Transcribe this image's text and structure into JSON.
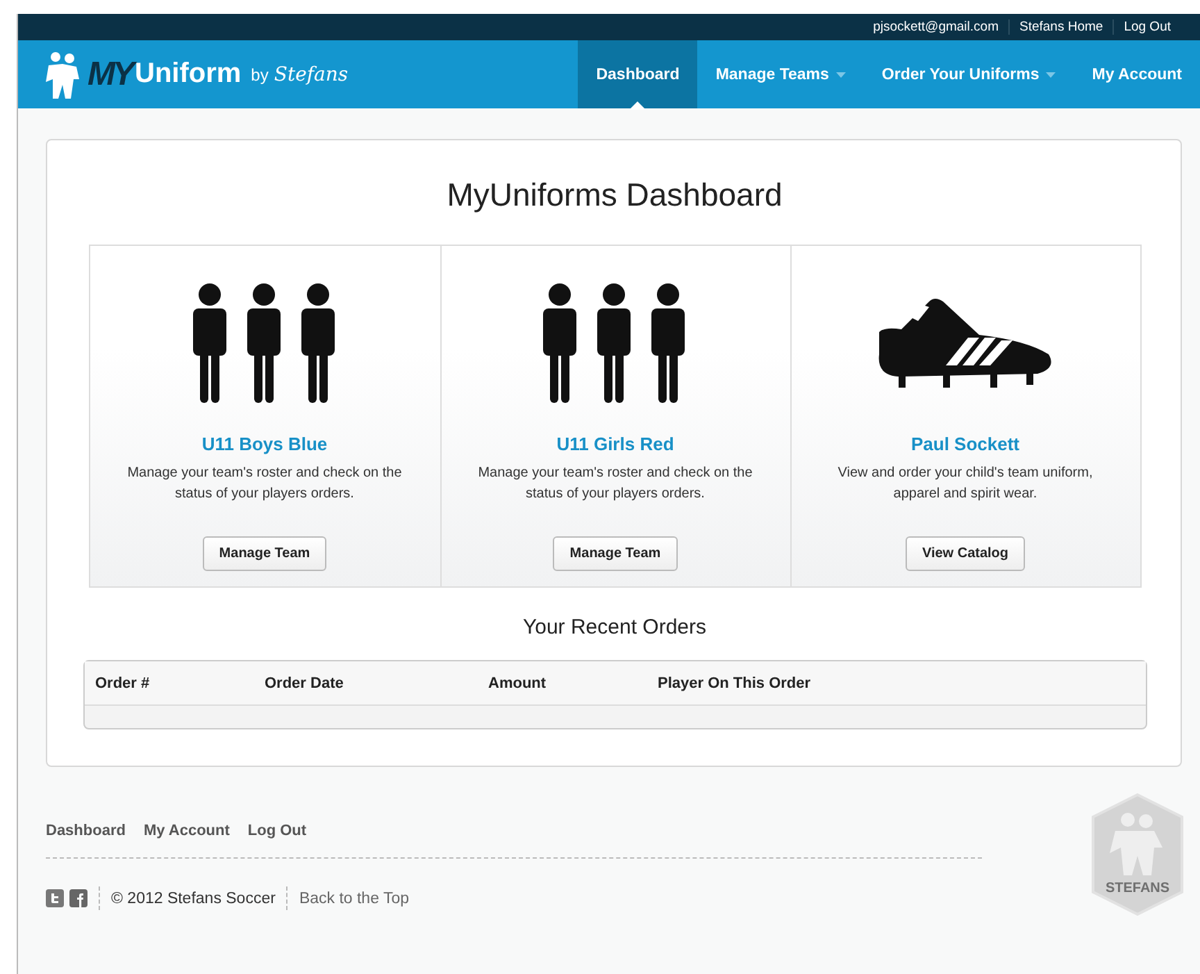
{
  "top_bar": {
    "links": [
      "pjsockett@gmail.com",
      "Stefans Home",
      "Log Out"
    ]
  },
  "logo": {
    "mark": "MY",
    "word": "Uniform",
    "by": "by",
    "brand": "Stefans"
  },
  "nav": [
    {
      "label": "Dashboard",
      "selected": true,
      "dropdown": false
    },
    {
      "label": "Manage Teams",
      "selected": false,
      "dropdown": true
    },
    {
      "label": "Order Your Uniforms",
      "selected": false,
      "dropdown": true
    },
    {
      "label": "My Account",
      "selected": false,
      "dropdown": false
    }
  ],
  "title": "MyUniforms Dashboard",
  "tiles": [
    {
      "kind": "team",
      "name": "U11 Boys Blue",
      "description": "Manage your team's roster and check on the status of your players orders.",
      "button": "Manage Team"
    },
    {
      "kind": "team",
      "name": "U11 Girls Red",
      "description": "Manage your team's roster and check on the status of your players orders.",
      "button": "Manage Team"
    },
    {
      "kind": "catalog",
      "name": "Paul Sockett",
      "description": "View and order your child's team uniform, apparel and spirit wear.",
      "button": "View Catalog"
    }
  ],
  "orders": {
    "title": "Your Recent Orders",
    "columns": [
      "Order #",
      "Order Date",
      "Amount",
      "Player On This Order"
    ]
  },
  "footer": {
    "links": [
      "Dashboard",
      "My Account",
      "Log Out"
    ],
    "copyright": "© 2012 Stefans Soccer",
    "back_to_top": "Back to the Top",
    "badge": "STEFANS"
  }
}
